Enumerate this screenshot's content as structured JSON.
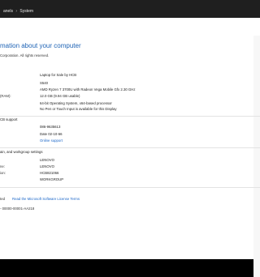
{
  "window": {
    "breadcrumb": {
      "first": "anels",
      "separator": "›",
      "current": "System"
    }
  },
  "page": {
    "heading": "mation about your computer",
    "copyright": "Corporation. All rights reserved."
  },
  "system": {
    "rating_value": "Laptop for Sale by HCB",
    "processor_value": "S540",
    "processor_detail": "AMD Ryzen 7 3700U with Radeon Vega Mobile Gfx     2.30 GHz",
    "ram_label": "(RAM):",
    "ram_value": "12.0 GB (9.94 GB usable)",
    "system_type_value": "64-bit Operating System, x64-based processor",
    "pen_touch_value": "No Pen or Touch Input is available for this Display"
  },
  "support": {
    "section_title": "CB support",
    "phone": "086-9635613",
    "hours": "Date 02-10-66",
    "online_support": "Online support"
  },
  "computer_name": {
    "section_title": "ain, and workgroup settings",
    "computer_name_value": "LENOVO",
    "full_name_label": "ne:",
    "full_name_value": "LENOVO",
    "description_label": "ion:",
    "description_value": "HCB821066",
    "workgroup_value": "WORKGROUP"
  },
  "activation": {
    "status_label": "ted",
    "license_link": "Read the Microsoft Software License Terms",
    "product_id": "- 00000-00001-AA218"
  }
}
